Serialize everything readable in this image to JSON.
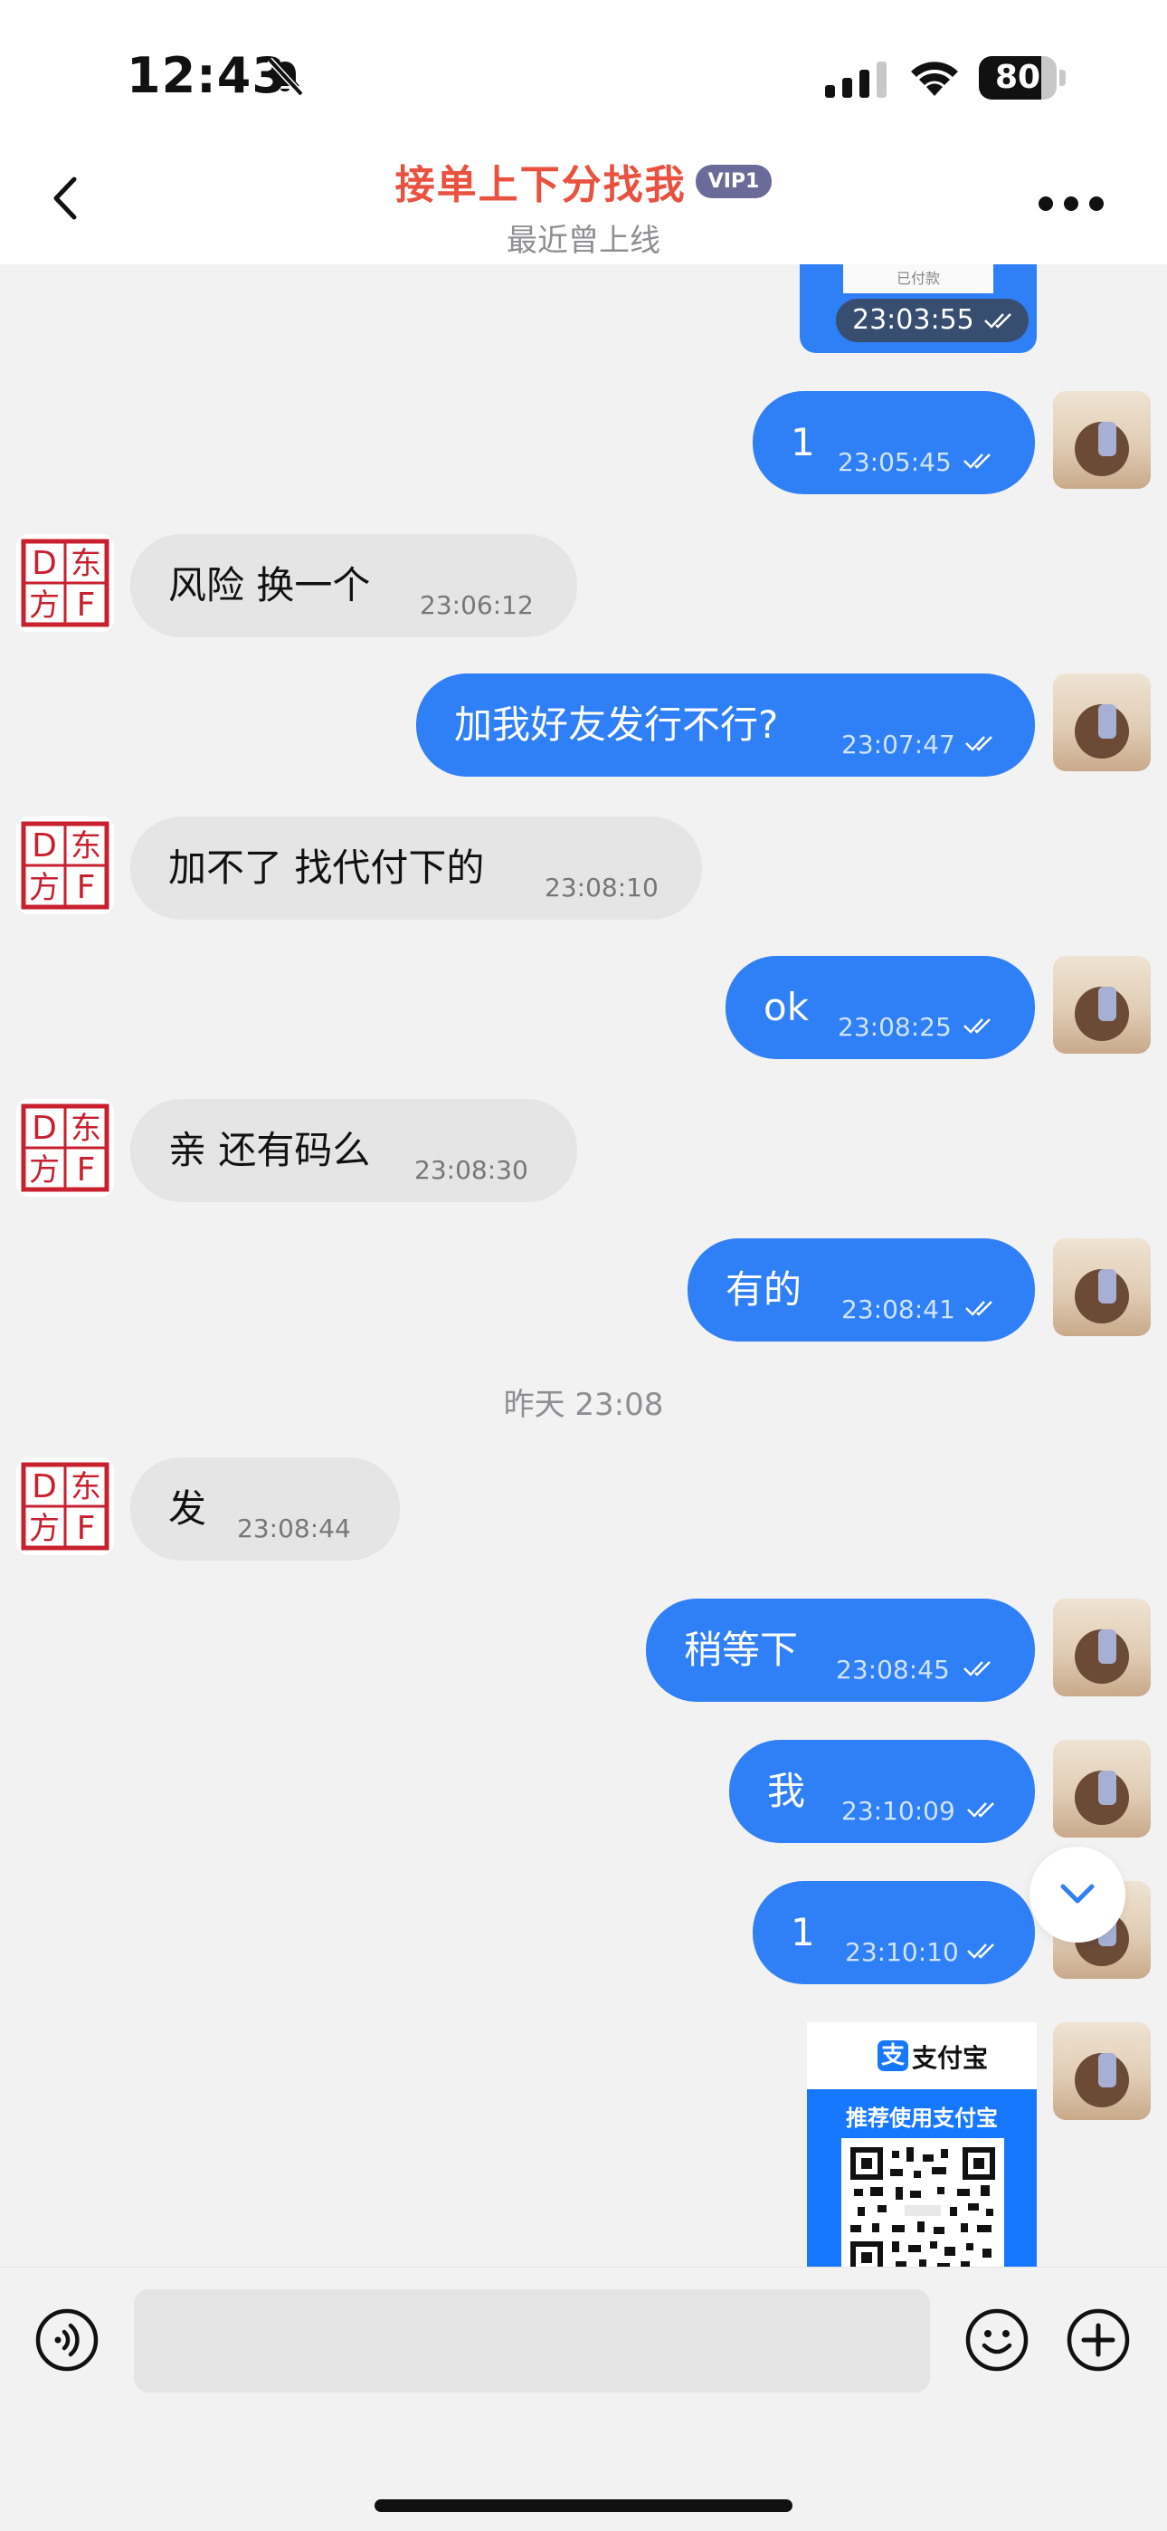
{
  "status_bar": {
    "time": "12:43",
    "battery": "80",
    "battery_level": 0.8,
    "icons": [
      "bell-slash-icon",
      "signal-bars-icon",
      "wifi-icon",
      "battery-icon"
    ]
  },
  "header": {
    "title": "接单上下分找我",
    "badge": "VIP1",
    "subtitle": "最近曾上线",
    "icons": [
      "chevron-left-icon",
      "more-dots-icon"
    ],
    "accent_color": "#e8523f"
  },
  "contact_avatar": {
    "seal_characters": [
      "D",
      "东",
      "方",
      "F"
    ],
    "seal_color": "#c8202e"
  },
  "top_image": {
    "paper_text": "已付款",
    "time": "23:03:55"
  },
  "messages": [
    {
      "direction": "out",
      "text": "1",
      "time": "23:05:45"
    },
    {
      "direction": "in",
      "text": "风险 换一个",
      "time": "23:06:12"
    },
    {
      "direction": "out",
      "text": "加我好友发行不行?",
      "time": "23:07:47"
    },
    {
      "direction": "in",
      "text": "加不了 找代付下的",
      "time": "23:08:10"
    },
    {
      "direction": "out",
      "text": "ok",
      "time": "23:08:25"
    },
    {
      "direction": "in",
      "text": "亲 还有码么",
      "time": "23:08:30"
    },
    {
      "direction": "out",
      "text": "有的",
      "time": "23:08:41"
    },
    {
      "direction": "in",
      "text": "发",
      "time": "23:08:44"
    },
    {
      "direction": "out",
      "text": "稍等下",
      "time": "23:08:45"
    },
    {
      "direction": "out",
      "text": "我",
      "time": "23:10:09"
    },
    {
      "direction": "out",
      "text": "1",
      "time": "23:10:10"
    }
  ],
  "day_divider": "昨天 23:08",
  "alipay_card": {
    "logo_char": "支",
    "app_name": "支付宝",
    "recommend": "推荐使用支付宝"
  },
  "input": {
    "placeholder": "",
    "value": ""
  },
  "colors": {
    "outgoing_bubble": "#2f7ff6",
    "incoming_bubble": "#e5e5e5",
    "background": "#f2f2f2",
    "alipay_blue": "#1677ff"
  }
}
